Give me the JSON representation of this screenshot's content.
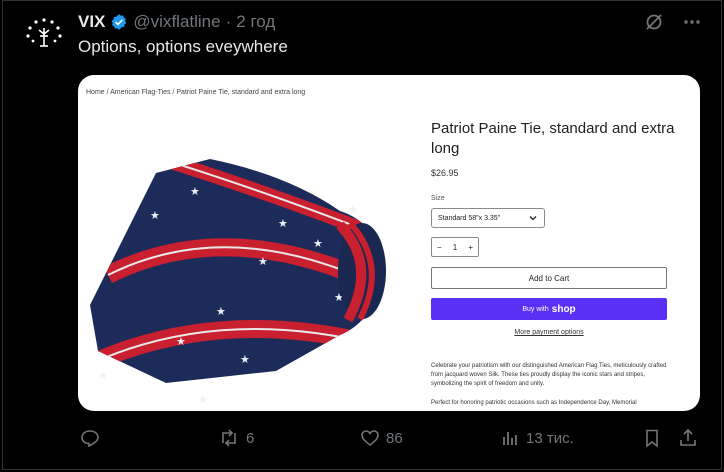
{
  "post": {
    "display_name": "VIX",
    "handle": "@vixflatline",
    "separator": "·",
    "time": "2 год",
    "text": "Options, options eveywhere"
  },
  "product_page": {
    "breadcrumb": "Home / American Flag-Ties / Patriot Paine Tie, standard and extra long",
    "title": "Patriot Paine Tie, standard and extra long",
    "price": "$26.95",
    "size_label": "Size",
    "size_value": "Standard 58\"x 3.35\"",
    "qty_minus": "−",
    "qty_value": "1",
    "qty_plus": "+",
    "add_to_cart": "Add to Cart",
    "buy_with": "Buy with",
    "buy_brand": "shop",
    "more_payment": "More payment options",
    "description": "Celebrate your patriotism with our distinguished American Flag Ties, meticulously crafted from jacquard woven Silk. These ties proudly display the iconic stars and stripes, symbolizing the spirit of freedom and unity.",
    "description_2": "Perfect for honoring patriotic occasions such as Independence Day, Memorial"
  },
  "actions": {
    "reposts": "6",
    "likes": "86",
    "views": "13 тис."
  },
  "icons": {
    "verified": "verified-badge-icon",
    "grok": "grok-icon",
    "more": "more-icon",
    "reply": "reply-icon",
    "repost": "repost-icon",
    "like": "like-icon",
    "views": "views-icon",
    "bookmark": "bookmark-icon",
    "share": "share-icon"
  },
  "colors": {
    "background": "#000000",
    "verified": "#1d9bf0",
    "muted": "#71767b",
    "shop_button": "#5a31f4",
    "tie_navy": "#1d2b5a",
    "tie_red": "#c8202f"
  }
}
